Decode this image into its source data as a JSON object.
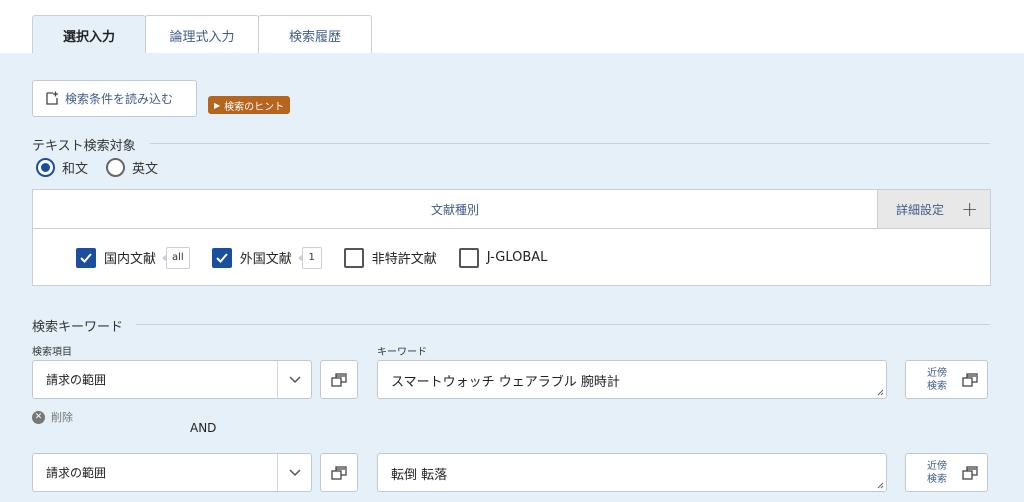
{
  "tabs": [
    {
      "label": "選択入力",
      "active": true
    },
    {
      "label": "論理式入力",
      "active": false
    },
    {
      "label": "検索履歴",
      "active": false
    }
  ],
  "load_button": {
    "label": "検索条件を読み込む",
    "icon": "load-conditions-icon"
  },
  "hint": {
    "label": "検索のヒント"
  },
  "text_target": {
    "title": "テキスト検索対象",
    "options": [
      {
        "label": "和文",
        "checked": true
      },
      {
        "label": "英文",
        "checked": false
      }
    ]
  },
  "doc_types": {
    "title": "文献種別",
    "detail_label": "詳細設定",
    "items": [
      {
        "label": "国内文献",
        "checked": true,
        "count": "all"
      },
      {
        "label": "外国文献",
        "checked": true,
        "count": "1"
      },
      {
        "label": "非特許文献",
        "checked": false,
        "count": null
      },
      {
        "label": "J-GLOBAL",
        "checked": false,
        "count": null
      }
    ]
  },
  "keyword_section": {
    "title": "検索キーワード",
    "field_label": "検索項目",
    "keyword_label": "キーワード",
    "delete_label": "削除",
    "operator": "AND",
    "near_label_1": "近傍",
    "near_label_2": "検索",
    "rows": [
      {
        "field": "請求の範囲",
        "keyword": "スマートウォッチ ウェアラブル 腕時計"
      },
      {
        "field": "請求の範囲",
        "keyword": "転倒 転落"
      }
    ]
  },
  "colors": {
    "accent": "#1a4fa0",
    "panel_bg": "#e6f0f9",
    "hint_bg": "#b5651d",
    "link": "#3f5d8a"
  }
}
